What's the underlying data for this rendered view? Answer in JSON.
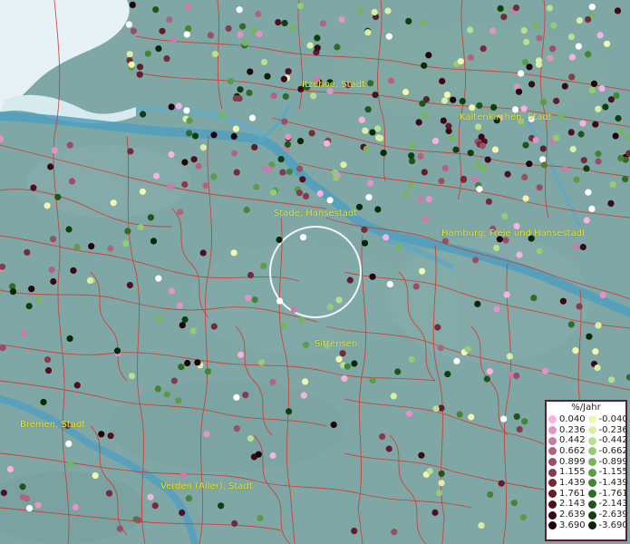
{
  "map": {
    "cities": [
      {
        "id": "itzehoe",
        "label": "Itzehoe, Stadt"
      },
      {
        "id": "kaltenkirchen",
        "label": "Kaltenkirchen, Stadt"
      },
      {
        "id": "stade",
        "label": "Stade, Hansestadt"
      },
      {
        "id": "hamburg",
        "label": "Hamburg, Freie und Hansestadt"
      },
      {
        "id": "sittensen",
        "label": "Sittensen"
      },
      {
        "id": "bremen",
        "label": "Bremen, Stadt"
      },
      {
        "id": "verden",
        "label": "Verden (Aller), Stadt"
      }
    ]
  },
  "legend": {
    "title": "%/Jahr",
    "positive": [
      {
        "value": "0.040",
        "color": "#f5b3e0"
      },
      {
        "value": "0.236",
        "color": "#e294c6"
      },
      {
        "value": "0.442",
        "color": "#c97ca8"
      },
      {
        "value": "0.662",
        "color": "#b0657f"
      },
      {
        "value": "0.899",
        "color": "#9a4e64"
      },
      {
        "value": "1.155",
        "color": "#853b4d"
      },
      {
        "value": "1.439",
        "color": "#732b3b"
      },
      {
        "value": "1.761",
        "color": "#601d2b"
      },
      {
        "value": "2.143",
        "color": "#4e121f"
      },
      {
        "value": "2.639",
        "color": "#380a14"
      },
      {
        "value": "3.690",
        "color": "#200408"
      }
    ],
    "negative": [
      {
        "value": "-0.040",
        "color": "#f2f7b0"
      },
      {
        "value": "-0.236",
        "color": "#d8efa5"
      },
      {
        "value": "-0.442",
        "color": "#b8e08e"
      },
      {
        "value": "-0.662",
        "color": "#96cb73"
      },
      {
        "value": "-0.899",
        "color": "#76b55c"
      },
      {
        "value": "-1.155",
        "color": "#5c9c48"
      },
      {
        "value": "-1.439",
        "color": "#448437"
      },
      {
        "value": "-1.761",
        "color": "#2f6c27"
      },
      {
        "value": "-2.143",
        "color": "#1d551a"
      },
      {
        "value": "-2.639",
        "color": "#0f3e0f"
      },
      {
        "value": "-3.690",
        "color": "#062806"
      }
    ]
  }
}
